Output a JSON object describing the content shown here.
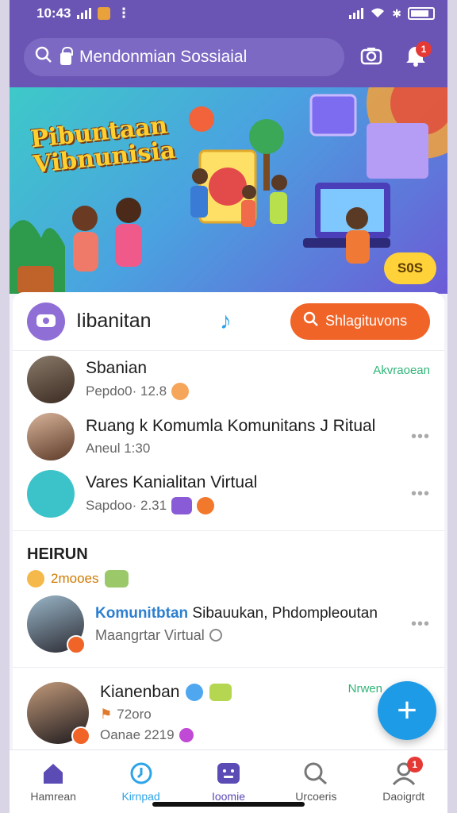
{
  "status": {
    "time": "10:43",
    "battery": ""
  },
  "header": {
    "search_text": "Mendonmian Sossiaial",
    "notification_count": "1",
    "icons": [
      "search-icon",
      "lock-icon",
      "camera-icon",
      "bell-icon"
    ]
  },
  "banner": {
    "title": "Pibuntaan Vibnunisia",
    "badge": "S0S"
  },
  "panel": {
    "title": "Iibanitan",
    "button_label": "Shlagituvons",
    "rows": [
      {
        "title": "Sbanian",
        "sub": "Pepdo0· 12.8",
        "meta": "Akvraoean"
      },
      {
        "title": "Ruang k Komumla Komunitans J Ritual",
        "sub": "Aneul 1:30",
        "meta": ""
      },
      {
        "title": "Vares Kanialitan Virtual",
        "sub": "Sapdoo· 2.31",
        "meta": ""
      }
    ]
  },
  "section": {
    "title": "HEIRUN",
    "tag": "2mooes",
    "items": [
      {
        "link": "Komunitbtan",
        "title": " Sibauukan, Phdompleoutan",
        "sub": "Maangrtar Virtual"
      },
      {
        "title": "Kianenban",
        "sub1": "72oro",
        "sub2": "Oanae 2219",
        "meta": "Nrwen"
      }
    ]
  },
  "nav": {
    "items": [
      {
        "label": "Hamrean",
        "icon": "home-icon"
      },
      {
        "label": "Kirnpad",
        "icon": "clock-icon"
      },
      {
        "label": "Ioomie",
        "icon": "chat-icon"
      },
      {
        "label": "Urcoeris",
        "icon": "search-icon"
      },
      {
        "label": "Daoigrdt",
        "icon": "profile-icon",
        "badge": "1"
      }
    ]
  },
  "colors": {
    "header": "#6a55b5",
    "accent": "#f06428",
    "fab": "#1e9be6",
    "meta": "#2fb578"
  }
}
